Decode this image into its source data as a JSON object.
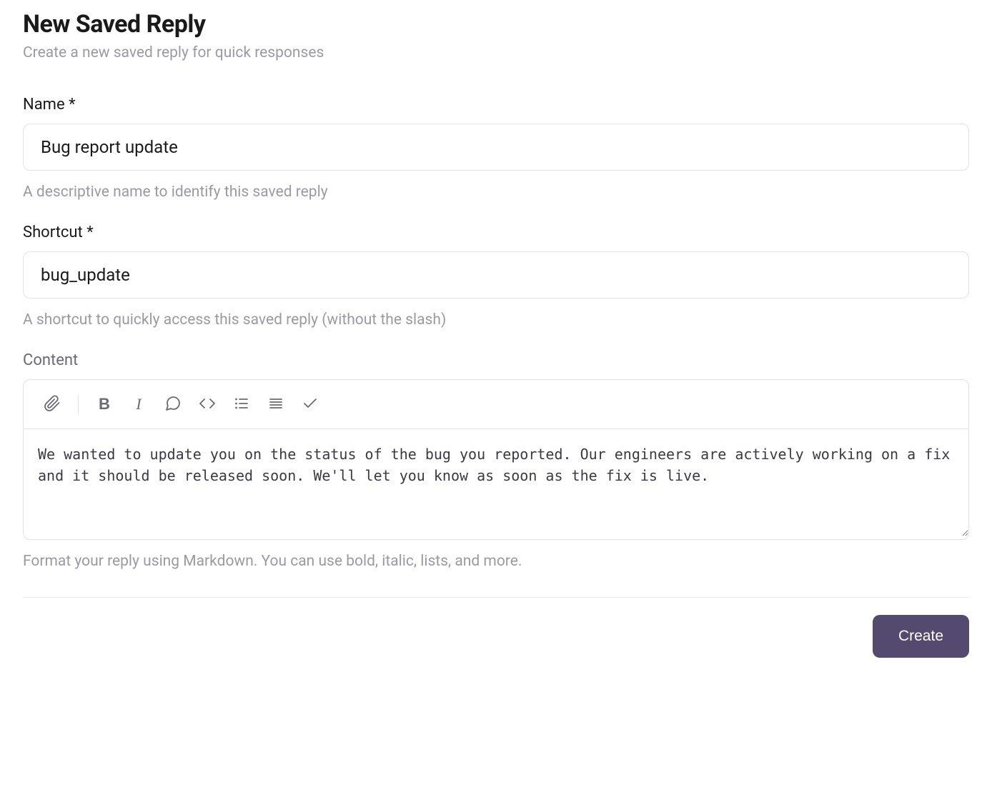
{
  "header": {
    "title": "New Saved Reply",
    "subtitle": "Create a new saved reply for quick responses"
  },
  "name_field": {
    "label": "Name *",
    "value": "Bug report update",
    "help": "A descriptive name to identify this saved reply"
  },
  "shortcut_field": {
    "label": "Shortcut *",
    "value": "bug_update",
    "help": "A shortcut to quickly access this saved reply (without the slash)"
  },
  "content_field": {
    "label": "Content",
    "value": "We wanted to update you on the status of the bug you reported. Our engineers are actively working on a fix and it should be released soon. We'll let you know as soon as the fix is live.",
    "help": "Format your reply using Markdown. You can use bold, italic, lists, and more."
  },
  "toolbar": {
    "bold_glyph": "B",
    "italic_glyph": "I"
  },
  "actions": {
    "create_label": "Create"
  }
}
